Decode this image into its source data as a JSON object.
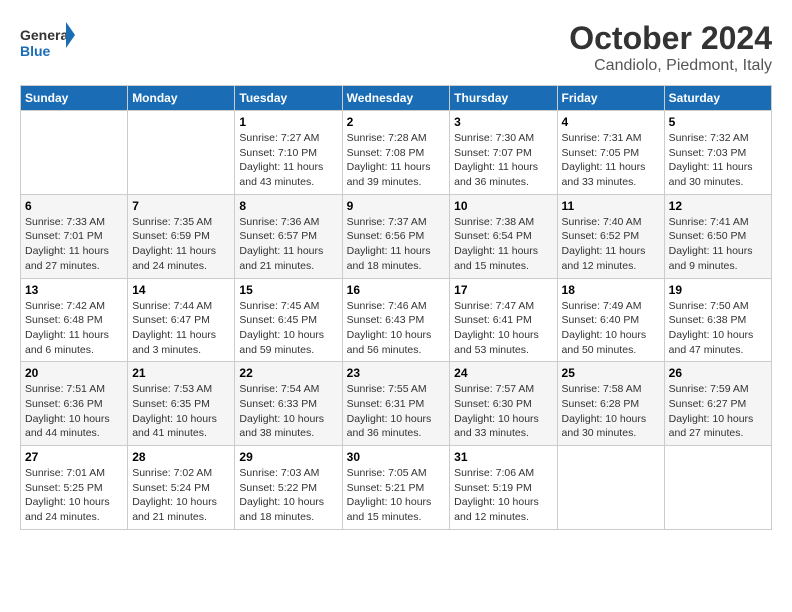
{
  "header": {
    "logo": {
      "line1": "General",
      "line2": "Blue"
    },
    "title": "October 2024",
    "location": "Candiolo, Piedmont, Italy"
  },
  "weekdays": [
    "Sunday",
    "Monday",
    "Tuesday",
    "Wednesday",
    "Thursday",
    "Friday",
    "Saturday"
  ],
  "weeks": [
    [
      {
        "day": "",
        "sunrise": "",
        "sunset": "",
        "daylight": ""
      },
      {
        "day": "",
        "sunrise": "",
        "sunset": "",
        "daylight": ""
      },
      {
        "day": "1",
        "sunrise": "Sunrise: 7:27 AM",
        "sunset": "Sunset: 7:10 PM",
        "daylight": "Daylight: 11 hours and 43 minutes."
      },
      {
        "day": "2",
        "sunrise": "Sunrise: 7:28 AM",
        "sunset": "Sunset: 7:08 PM",
        "daylight": "Daylight: 11 hours and 39 minutes."
      },
      {
        "day": "3",
        "sunrise": "Sunrise: 7:30 AM",
        "sunset": "Sunset: 7:07 PM",
        "daylight": "Daylight: 11 hours and 36 minutes."
      },
      {
        "day": "4",
        "sunrise": "Sunrise: 7:31 AM",
        "sunset": "Sunset: 7:05 PM",
        "daylight": "Daylight: 11 hours and 33 minutes."
      },
      {
        "day": "5",
        "sunrise": "Sunrise: 7:32 AM",
        "sunset": "Sunset: 7:03 PM",
        "daylight": "Daylight: 11 hours and 30 minutes."
      }
    ],
    [
      {
        "day": "6",
        "sunrise": "Sunrise: 7:33 AM",
        "sunset": "Sunset: 7:01 PM",
        "daylight": "Daylight: 11 hours and 27 minutes."
      },
      {
        "day": "7",
        "sunrise": "Sunrise: 7:35 AM",
        "sunset": "Sunset: 6:59 PM",
        "daylight": "Daylight: 11 hours and 24 minutes."
      },
      {
        "day": "8",
        "sunrise": "Sunrise: 7:36 AM",
        "sunset": "Sunset: 6:57 PM",
        "daylight": "Daylight: 11 hours and 21 minutes."
      },
      {
        "day": "9",
        "sunrise": "Sunrise: 7:37 AM",
        "sunset": "Sunset: 6:56 PM",
        "daylight": "Daylight: 11 hours and 18 minutes."
      },
      {
        "day": "10",
        "sunrise": "Sunrise: 7:38 AM",
        "sunset": "Sunset: 6:54 PM",
        "daylight": "Daylight: 11 hours and 15 minutes."
      },
      {
        "day": "11",
        "sunrise": "Sunrise: 7:40 AM",
        "sunset": "Sunset: 6:52 PM",
        "daylight": "Daylight: 11 hours and 12 minutes."
      },
      {
        "day": "12",
        "sunrise": "Sunrise: 7:41 AM",
        "sunset": "Sunset: 6:50 PM",
        "daylight": "Daylight: 11 hours and 9 minutes."
      }
    ],
    [
      {
        "day": "13",
        "sunrise": "Sunrise: 7:42 AM",
        "sunset": "Sunset: 6:48 PM",
        "daylight": "Daylight: 11 hours and 6 minutes."
      },
      {
        "day": "14",
        "sunrise": "Sunrise: 7:44 AM",
        "sunset": "Sunset: 6:47 PM",
        "daylight": "Daylight: 11 hours and 3 minutes."
      },
      {
        "day": "15",
        "sunrise": "Sunrise: 7:45 AM",
        "sunset": "Sunset: 6:45 PM",
        "daylight": "Daylight: 10 hours and 59 minutes."
      },
      {
        "day": "16",
        "sunrise": "Sunrise: 7:46 AM",
        "sunset": "Sunset: 6:43 PM",
        "daylight": "Daylight: 10 hours and 56 minutes."
      },
      {
        "day": "17",
        "sunrise": "Sunrise: 7:47 AM",
        "sunset": "Sunset: 6:41 PM",
        "daylight": "Daylight: 10 hours and 53 minutes."
      },
      {
        "day": "18",
        "sunrise": "Sunrise: 7:49 AM",
        "sunset": "Sunset: 6:40 PM",
        "daylight": "Daylight: 10 hours and 50 minutes."
      },
      {
        "day": "19",
        "sunrise": "Sunrise: 7:50 AM",
        "sunset": "Sunset: 6:38 PM",
        "daylight": "Daylight: 10 hours and 47 minutes."
      }
    ],
    [
      {
        "day": "20",
        "sunrise": "Sunrise: 7:51 AM",
        "sunset": "Sunset: 6:36 PM",
        "daylight": "Daylight: 10 hours and 44 minutes."
      },
      {
        "day": "21",
        "sunrise": "Sunrise: 7:53 AM",
        "sunset": "Sunset: 6:35 PM",
        "daylight": "Daylight: 10 hours and 41 minutes."
      },
      {
        "day": "22",
        "sunrise": "Sunrise: 7:54 AM",
        "sunset": "Sunset: 6:33 PM",
        "daylight": "Daylight: 10 hours and 38 minutes."
      },
      {
        "day": "23",
        "sunrise": "Sunrise: 7:55 AM",
        "sunset": "Sunset: 6:31 PM",
        "daylight": "Daylight: 10 hours and 36 minutes."
      },
      {
        "day": "24",
        "sunrise": "Sunrise: 7:57 AM",
        "sunset": "Sunset: 6:30 PM",
        "daylight": "Daylight: 10 hours and 33 minutes."
      },
      {
        "day": "25",
        "sunrise": "Sunrise: 7:58 AM",
        "sunset": "Sunset: 6:28 PM",
        "daylight": "Daylight: 10 hours and 30 minutes."
      },
      {
        "day": "26",
        "sunrise": "Sunrise: 7:59 AM",
        "sunset": "Sunset: 6:27 PM",
        "daylight": "Daylight: 10 hours and 27 minutes."
      }
    ],
    [
      {
        "day": "27",
        "sunrise": "Sunrise: 7:01 AM",
        "sunset": "Sunset: 5:25 PM",
        "daylight": "Daylight: 10 hours and 24 minutes."
      },
      {
        "day": "28",
        "sunrise": "Sunrise: 7:02 AM",
        "sunset": "Sunset: 5:24 PM",
        "daylight": "Daylight: 10 hours and 21 minutes."
      },
      {
        "day": "29",
        "sunrise": "Sunrise: 7:03 AM",
        "sunset": "Sunset: 5:22 PM",
        "daylight": "Daylight: 10 hours and 18 minutes."
      },
      {
        "day": "30",
        "sunrise": "Sunrise: 7:05 AM",
        "sunset": "Sunset: 5:21 PM",
        "daylight": "Daylight: 10 hours and 15 minutes."
      },
      {
        "day": "31",
        "sunrise": "Sunrise: 7:06 AM",
        "sunset": "Sunset: 5:19 PM",
        "daylight": "Daylight: 10 hours and 12 minutes."
      },
      {
        "day": "",
        "sunrise": "",
        "sunset": "",
        "daylight": ""
      },
      {
        "day": "",
        "sunrise": "",
        "sunset": "",
        "daylight": ""
      }
    ]
  ]
}
